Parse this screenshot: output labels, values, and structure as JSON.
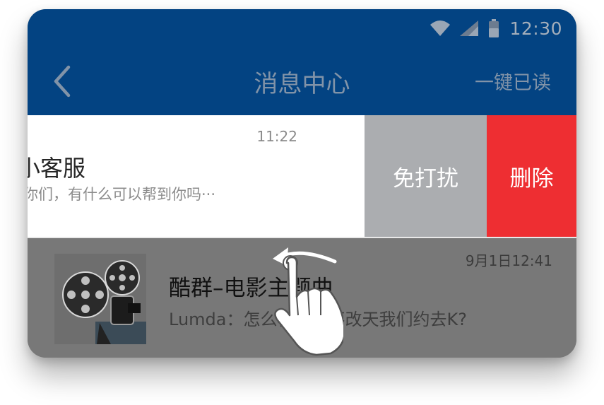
{
  "status_bar": {
    "time": "12:30",
    "icons": [
      "wifi-icon",
      "cell-signal-icon",
      "battery-icon"
    ]
  },
  "header": {
    "title": "消息中心",
    "back_icon": "chevron-left-icon",
    "action": "一键已读"
  },
  "messages": [
    {
      "name": "小客服",
      "preview": "你们，有什么可以帮到你吗···",
      "time": "11:22",
      "swipe_actions": [
        "免打扰",
        "删除"
      ]
    },
    {
      "name": "酷群–电影主题曲",
      "preview": "Lumda：怎么样，要不改天我们约去K?",
      "time": "9月1日12:41",
      "avatar": "film-projector-image"
    }
  ],
  "colors": {
    "header_bg": "#034382",
    "mute_bg": "#abadb0",
    "delete_bg": "#ee2e32",
    "overlay": "#787878"
  },
  "gesture": "swipe-left-hand-icon"
}
